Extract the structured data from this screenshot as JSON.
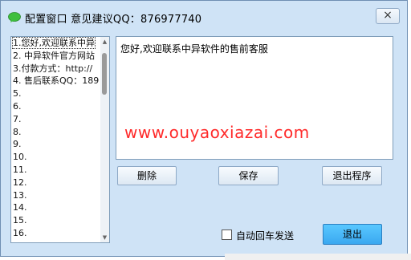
{
  "window": {
    "title": "配置窗口 意见建议QQ：876977740",
    "close_label": "×"
  },
  "phrase_list": {
    "items": [
      "1.您好,欢迎联系中异",
      "2. 中异软件官方网站",
      "3.付款方式：http://",
      "4. 售后联系QQ：189",
      "5.",
      "6.",
      "7.",
      "8.",
      "9.",
      "10.",
      "11.",
      "12.",
      "13.",
      "14.",
      "15.",
      "16."
    ],
    "selected_index": 0,
    "scroll_up": "▲",
    "scroll_down": "▼"
  },
  "editor": {
    "text": "您好,欢迎联系中异软件的售前客服"
  },
  "watermark": "www.ouyaoxiazai.com",
  "buttons": {
    "delete_label": "删除",
    "save_label": "保存",
    "quit_program_label": "退出程序",
    "exit_label": "退出"
  },
  "options": {
    "auto_enter_send_label": "自动回车发送",
    "auto_enter_send_checked": false
  },
  "colors": {
    "window_bg": "#cfe3f6",
    "watermark": "#ff2a2a",
    "exit_button": "#3aa8f0"
  }
}
